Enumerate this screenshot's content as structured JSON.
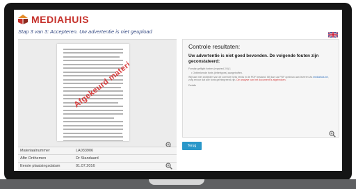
{
  "brand": {
    "name": "MEDIAHUIS",
    "color": "#c6322c"
  },
  "step_title": "Stap 3 van 3: Accepteren. Uw advertentie is niet geupload",
  "document": {
    "stamp_text": "Afgekeurd materiaal"
  },
  "info_rows": [
    {
      "label": "Materiaalnummer",
      "value": "LA033906"
    },
    {
      "label": "Afbr Onthemen",
      "value": "Dr Standaard"
    },
    {
      "label": "Eerste plaatsingsdatum",
      "value": "01.07.2016"
    }
  ],
  "results": {
    "title": "Controle resultaten:",
    "subtitle": "Uw advertentie is niet goed bevonden. De volgende fouten zijn geconstateerd:",
    "line1": "Fonstje geflight fonten (repaired 2/4) 1",
    "line2": "• Ontbrekende fonts (lettertypes) aangetroffen.",
    "para_a": "Wijt aan niet anbieden van de correcte fonts reeds in de PDF bestand. Wij kan uw PDF opnieuw aan leveren via ",
    "link": "mediahuis.be",
    "para_b": ", zorg ervoor dat alle fonts geïntegreerd zijn. ",
    "err": "De analyse van het document is afgebroken.",
    "line_end": "Details"
  },
  "button": {
    "label": "Terug"
  },
  "icons": {
    "zoom": "zoom-in-icon",
    "flag": "uk-flag-icon",
    "logo": "mediahuis-logo-icon"
  }
}
